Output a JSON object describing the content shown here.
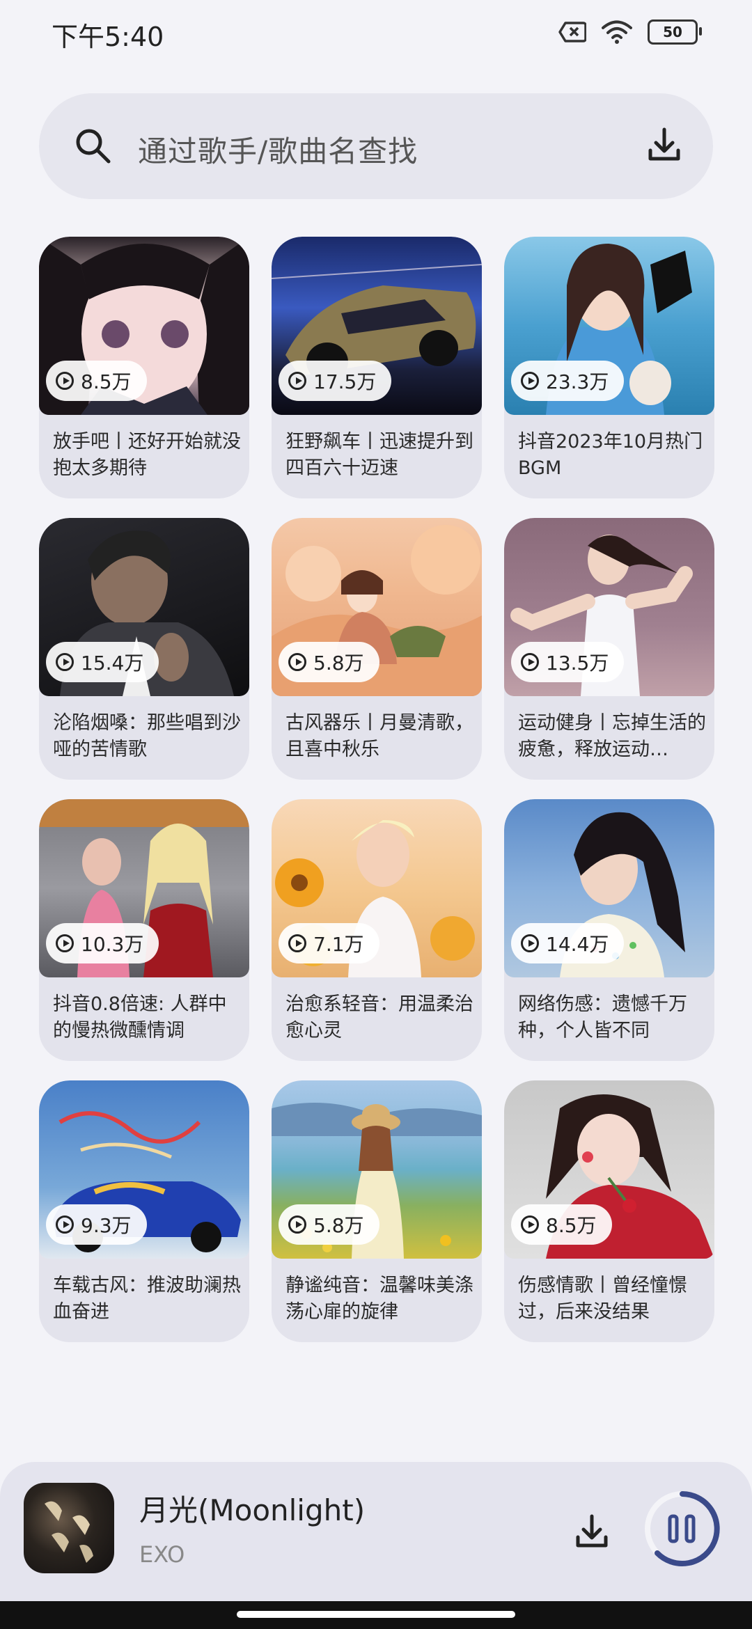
{
  "status": {
    "time": "下午5:40",
    "battery": "50"
  },
  "search": {
    "placeholder": "通过歌手/歌曲名查找"
  },
  "cards": [
    {
      "plays": "8.5万",
      "title": "放手吧丨还好开始就没抱太多期待"
    },
    {
      "plays": "17.5万",
      "title": "狂野飙车丨迅速提升到四百六十迈速"
    },
    {
      "plays": "23.3万",
      "title": "抖音2023年10月热门BGM"
    },
    {
      "plays": "15.4万",
      "title": "沦陷烟嗓：那些唱到沙哑的苦情歌"
    },
    {
      "plays": "5.8万",
      "title": "古风器乐丨月曼清歌，且喜中秋乐"
    },
    {
      "plays": "13.5万",
      "title": "运动健身丨忘掉生活的疲惫，释放运动…"
    },
    {
      "plays": "10.3万",
      "title": "抖音0.8倍速: 人群中的慢热微醺情调"
    },
    {
      "plays": "7.1万",
      "title": "治愈系轻音：用温柔治愈心灵"
    },
    {
      "plays": "14.4万",
      "title": "网络伤感：遗憾千万种，个人皆不同"
    },
    {
      "plays": "9.3万",
      "title": "车载古风：推波助澜热血奋进"
    },
    {
      "plays": "5.8万",
      "title": "静谧纯音：温馨味美涤荡心扉的旋律"
    },
    {
      "plays": "8.5万",
      "title": "伤感情歌丨曾经憧憬过，后来没结果"
    }
  ],
  "player": {
    "title": "月光(Moonlight)",
    "artist": "EXO"
  }
}
